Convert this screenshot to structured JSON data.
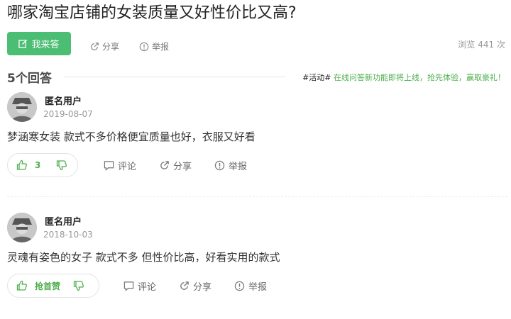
{
  "question": {
    "title": "哪家淘宝店铺的女装质量又好性价比又高?"
  },
  "actions": {
    "answer_label": "我来答",
    "share_label": "分享",
    "report_label": "举报"
  },
  "stats": {
    "views_label": "浏览",
    "views_value": "441 次"
  },
  "answers_header": {
    "count_label": "5个回答",
    "promo_tag": "#活动#",
    "promo_text": "在线问答新功能即将上线，抢先体验，赢取豪礼！"
  },
  "answers": [
    {
      "user": "匿名用户",
      "date": "2019-08-07",
      "content": "梦涵寒女装 款式不多价格便宜质量也好，衣服又好看",
      "likes": "3",
      "comment_label": "评论",
      "share_label": "分享",
      "report_label": "举报"
    },
    {
      "user": "匿名用户",
      "date": "2018-10-03",
      "content": "灵魂有姿色的女子 款式不多 但性价比高，好看实用的款式",
      "likes": "抢首赞",
      "comment_label": "评论",
      "share_label": "分享",
      "report_label": "举报"
    }
  ],
  "colors": {
    "accent": "#4cbe74",
    "promo": "#4cae4c",
    "muted": "#999999"
  }
}
